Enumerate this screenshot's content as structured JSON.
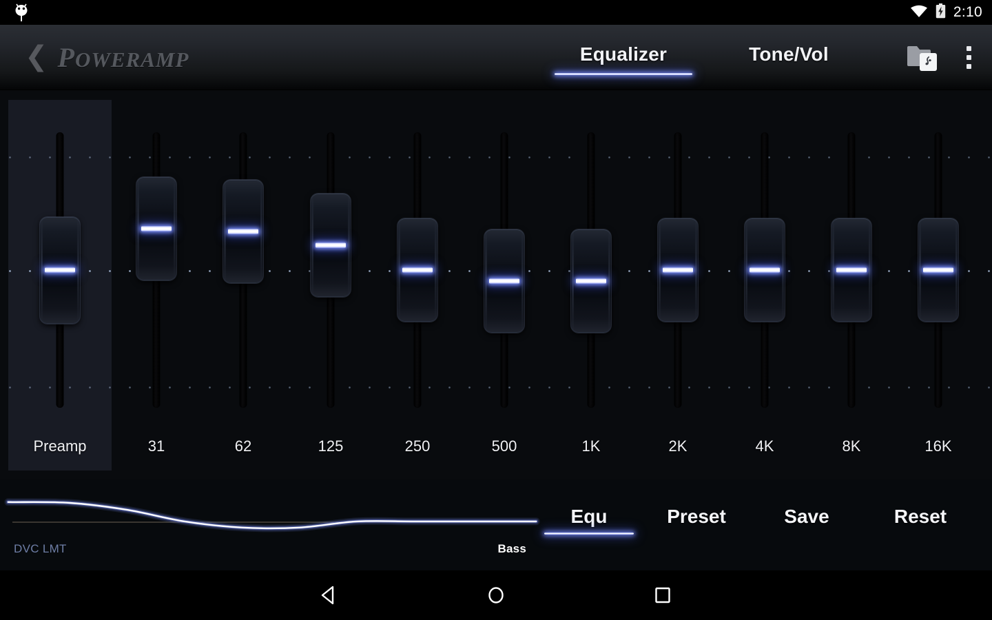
{
  "statusbar": {
    "time": "2:10",
    "icons": [
      "android-logo-icon",
      "wifi-icon",
      "battery-charging-icon"
    ]
  },
  "header": {
    "back_chevron": "❮",
    "brand_prefix": "P",
    "brand_rest": "OWERAMP",
    "brand_full": "POWERAMP",
    "tabs": [
      {
        "label": "Equalizer",
        "active": true
      },
      {
        "label": "Tone/Vol",
        "active": false
      }
    ],
    "icons": [
      {
        "name": "folder-music-icon",
        "label": "Folder with music"
      },
      {
        "name": "overflow-menu-icon",
        "label": "More options"
      }
    ],
    "accent": "#ffffff",
    "accent_glow": "#8090ff"
  },
  "equalizer": {
    "gridlines_db": [
      12,
      0,
      -12
    ],
    "bands": [
      {
        "label": "Preamp",
        "value_pct": 50.0,
        "highlighted": true
      },
      {
        "label": "31",
        "value_pct": 65.0,
        "highlighted": false
      },
      {
        "label": "62",
        "value_pct": 64.0,
        "highlighted": false
      },
      {
        "label": "125",
        "value_pct": 59.0,
        "highlighted": false
      },
      {
        "label": "250",
        "value_pct": 50.0,
        "highlighted": false
      },
      {
        "label": "500",
        "value_pct": 46.0,
        "highlighted": false
      },
      {
        "label": "1K",
        "value_pct": 46.0,
        "highlighted": false
      },
      {
        "label": "2K",
        "value_pct": 50.0,
        "highlighted": false
      },
      {
        "label": "4K",
        "value_pct": 50.0,
        "highlighted": false
      },
      {
        "label": "8K",
        "value_pct": 50.0,
        "highlighted": false
      },
      {
        "label": "16K",
        "value_pct": 50.0,
        "highlighted": false
      }
    ]
  },
  "chart_data": {
    "type": "line",
    "title": "EQ response curve",
    "xlabel": "",
    "ylabel": "",
    "x": [
      31,
      62,
      125,
      250,
      500,
      1000,
      2000,
      4000,
      8000,
      16000
    ],
    "values": [
      5.2,
      5.0,
      3.2,
      0.2,
      -1.4,
      -1.4,
      0.2,
      0.2,
      0.2,
      0.2
    ],
    "ylim": [
      -12,
      12
    ],
    "zero_line": true,
    "grid": false,
    "legend": "none",
    "left_label": "DVC LMT",
    "right_label": "Bass",
    "line_color": "#ffffff",
    "glow_color": "#6a7ad8"
  },
  "bottom_bar": {
    "left_label": "DVC LMT",
    "right_label": "Bass",
    "buttons": [
      {
        "label": "Equ",
        "active": true
      },
      {
        "label": "Preset",
        "active": false
      },
      {
        "label": "Save",
        "active": false
      },
      {
        "label": "Reset",
        "active": false
      }
    ]
  },
  "navbar": {
    "buttons": [
      {
        "name": "nav-back-button",
        "label": "Back"
      },
      {
        "name": "nav-home-button",
        "label": "Home"
      },
      {
        "name": "nav-recents-button",
        "label": "Recents"
      }
    ]
  }
}
